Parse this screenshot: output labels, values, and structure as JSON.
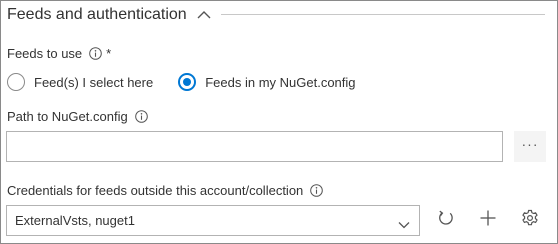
{
  "section": {
    "title": "Feeds and authentication",
    "collapse_icon": "chevron-up-icon"
  },
  "feeds": {
    "label": "Feeds to use",
    "required_mark": "*",
    "info_icon": "info-icon",
    "options": [
      {
        "label": "Feed(s) I select here",
        "selected": false
      },
      {
        "label": "Feeds in my NuGet.config",
        "selected": true
      }
    ]
  },
  "path": {
    "label": "Path to NuGet.config",
    "info_icon": "info-icon",
    "value": "",
    "browse_label": "···"
  },
  "credentials": {
    "label": "Credentials for feeds outside this account/collection",
    "info_icon": "info-icon",
    "selected_value": "ExternalVsts, nuget1",
    "buttons": [
      "refresh-icon",
      "add-icon",
      "gear-icon"
    ]
  },
  "colors": {
    "accent": "#0078d4",
    "text": "#333333",
    "border": "#b3b3b3"
  }
}
